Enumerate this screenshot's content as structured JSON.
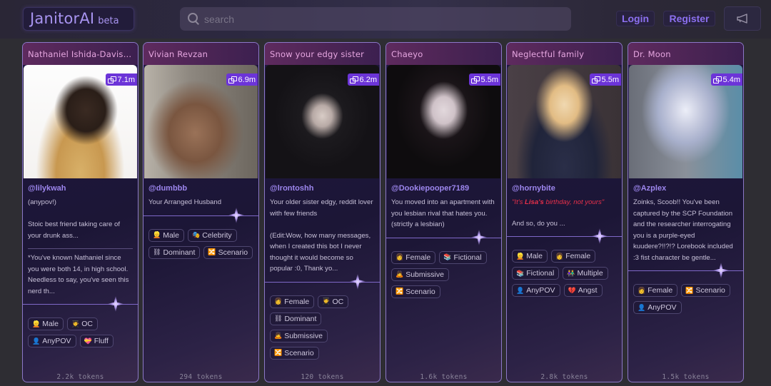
{
  "header": {
    "logo": "JanitorAI",
    "logo_badge": "beta",
    "search_placeholder": "search",
    "login_label": "Login",
    "register_label": "Register",
    "announcement_icon": "megaphone-icon"
  },
  "colors": {
    "accent": "#8c70f0",
    "card_header": "#5e2a5e",
    "badge": "#6c34d8"
  },
  "cards": [
    {
      "name": "Nathaniel Ishida-Davis ¬ r...",
      "messages": "7.1m",
      "creator": "@lilykwah",
      "description": "(anypov!)\n\nStoic best friend taking care of your drunk ass...",
      "description2": "*You've known Nathaniel since you were both 14, in high school. Needless to say, you've seen this nerd th...",
      "tags": [
        {
          "icon": "👱",
          "label": "Male"
        },
        {
          "icon": "🧑‍🎓",
          "label": "OC"
        },
        {
          "icon": "👤",
          "label": "AnyPOV"
        },
        {
          "icon": "💝",
          "label": "Fluff"
        }
      ],
      "tokens": "2.2k tokens"
    },
    {
      "name": "Vivian Revzan",
      "messages": "6.9m",
      "creator": "@dumbbb",
      "description": "Your Arranged Husband",
      "tags": [
        {
          "icon": "👱",
          "label": "Male"
        },
        {
          "icon": "🎭",
          "label": "Celebrity"
        },
        {
          "icon": "⛓",
          "label": "Dominant"
        },
        {
          "icon": "🔀",
          "label": "Scenario"
        }
      ],
      "tokens": "294 tokens"
    },
    {
      "name": "Snow your edgy sister",
      "messages": "6.2m",
      "creator": "@lrontoshh",
      "description": "Your older sister edgy, reddit lover with few friends\n\n(Edit:Wow, how many messages, when I created this bot I never thought it would become so popular :0, Thank yo...",
      "tags": [
        {
          "icon": "👩",
          "label": "Female"
        },
        {
          "icon": "🧑‍🎓",
          "label": "OC"
        },
        {
          "icon": "⛓",
          "label": "Dominant"
        },
        {
          "icon": "🙇",
          "label": "Submissive"
        },
        {
          "icon": "🔀",
          "label": "Scenario"
        }
      ],
      "tokens": "120 tokens"
    },
    {
      "name": "Chaeyo",
      "messages": "5.5m",
      "creator": "@Dookiepooper7189",
      "description": "You moved into an apartment with you lesbian rival that hates you. (strictly a lesbian)",
      "tags": [
        {
          "icon": "👩",
          "label": "Female"
        },
        {
          "icon": "📚",
          "label": "Fictional"
        },
        {
          "icon": "🙇",
          "label": "Submissive"
        },
        {
          "icon": "🔀",
          "label": "Scenario"
        }
      ],
      "tokens": "1.6k tokens"
    },
    {
      "name": "Neglectful family",
      "messages": "5.5m",
      "creator": "@hornybite",
      "description_red_pre": "\"It's ",
      "description_red_bold": "Lisa's",
      "description_red_post": " birthday, not yours\"",
      "description": "And so, do you ...",
      "tags": [
        {
          "icon": "👱",
          "label": "Male"
        },
        {
          "icon": "👩",
          "label": "Female"
        },
        {
          "icon": "📚",
          "label": "Fictional"
        },
        {
          "icon": "👫",
          "label": "Multiple"
        },
        {
          "icon": "👤",
          "label": "AnyPOV"
        },
        {
          "icon": "💔",
          "label": "Angst"
        }
      ],
      "tokens": "2.8k tokens"
    },
    {
      "name": "Dr. Moon",
      "messages": "5.4m",
      "creator": "@Azplex",
      "description": "Zoinks, Scoob!! You've been captured by the SCP Foundation and the researcher interrogating you is a purple-eyed kuudere?!!?!? Lorebook included :3 fist character be gentle...",
      "tags": [
        {
          "icon": "👩",
          "label": "Female"
        },
        {
          "icon": "🔀",
          "label": "Scenario"
        },
        {
          "icon": "👤",
          "label": "AnyPOV"
        }
      ],
      "tokens": "1.5k tokens"
    }
  ]
}
